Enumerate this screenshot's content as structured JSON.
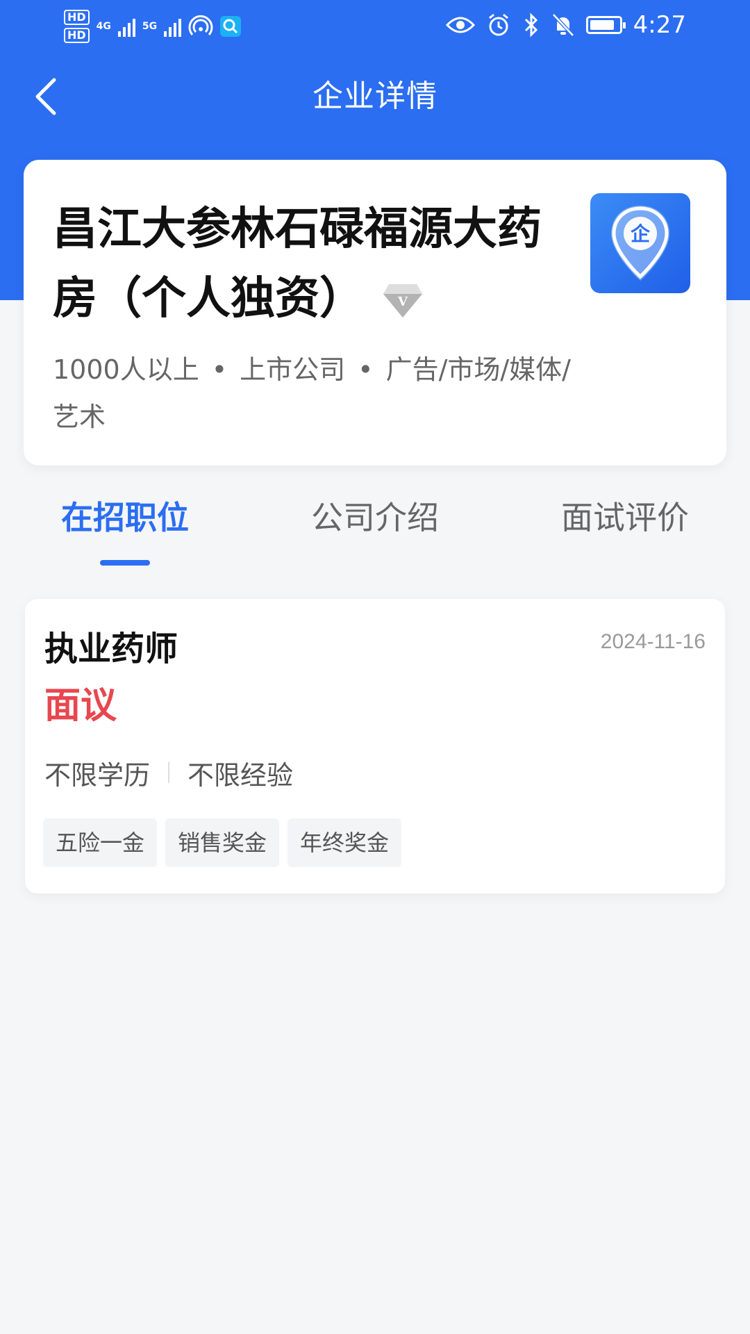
{
  "status_bar": {
    "time": "4:27",
    "hd1": "HD",
    "hd2": "HD",
    "net1": "4G",
    "net2": "5G",
    "icons": [
      "eye-icon",
      "alarm-icon",
      "bluetooth-icon",
      "mute-icon",
      "battery-icon"
    ]
  },
  "nav": {
    "title": "企业详情",
    "back_icon": "chevron-left-icon"
  },
  "company": {
    "name": "昌江大参林石碌福源大药房（个人独资）",
    "badge_icon": "diamond-v-icon",
    "size": "1000人以上",
    "type": "上市公司",
    "industry": "广告/市场/媒体/艺术",
    "separator": "•",
    "logo_char": "企"
  },
  "tabs": [
    {
      "label": "在招职位",
      "active": true
    },
    {
      "label": "公司介绍",
      "active": false
    },
    {
      "label": "面试评价",
      "active": false
    }
  ],
  "jobs": [
    {
      "title": "执业药师",
      "date": "2024-11-16",
      "salary": "面议",
      "education": "不限学历",
      "experience": "不限经验",
      "tags": [
        "五险一金",
        "销售奖金",
        "年终奖金"
      ]
    }
  ],
  "colors": {
    "primary": "#2b6ef2",
    "salary": "#e8474f",
    "background": "#f5f6f8"
  }
}
